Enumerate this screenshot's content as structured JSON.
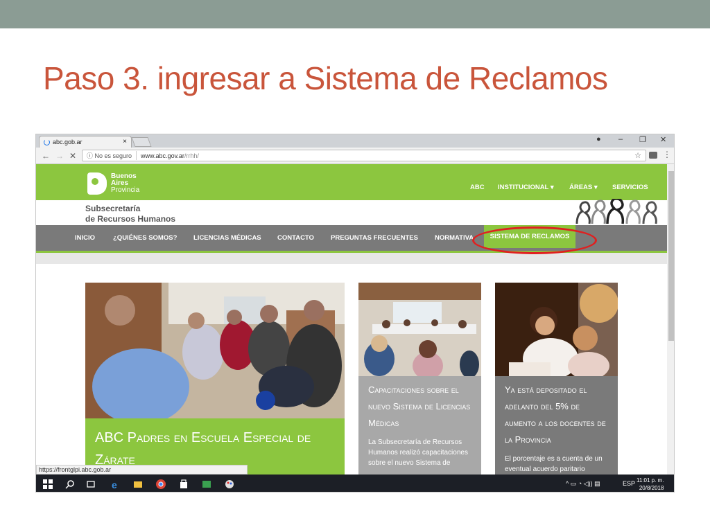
{
  "slide": {
    "title": "Paso 3.  ingresar a Sistema de Reclamos"
  },
  "browser": {
    "tab_title": "abc.gob.ar",
    "tab_close": "×",
    "security_label": "No es seguro",
    "url_domain": "www.abc.gov.ar",
    "url_path": "/rrhh/",
    "back": "←",
    "forward": "→",
    "stop": "✕",
    "star": "☆",
    "menu": "⋮",
    "win_account": "●",
    "win_minimize": "–",
    "win_restore": "❐",
    "win_close": "✕",
    "status_url": "https://frontglpi.abc.gob.ar"
  },
  "site": {
    "logo": {
      "line1": "Buenos",
      "line2": "Aires",
      "line3": "Provincia"
    },
    "top_nav": [
      "ABC",
      "INSTITUCIONAL ▾",
      "ÁREAS ▾",
      "SERVICIOS"
    ],
    "subsecretaria": {
      "line1": "Subsecretaría",
      "line2": "de Recursos Humanos"
    },
    "main_nav": [
      "INICIO",
      "¿QUIÉNES SOMOS?",
      "LICENCIAS MÉDICAS",
      "CONTACTO",
      "PREGUNTAS FRECUENTES",
      "NORMATIVA"
    ],
    "main_nav_active": "SISTEMA DE RECLAMOS",
    "cards": [
      {
        "title": "ABC Padres en Escuela Especial de Zárate"
      },
      {
        "title": "Capacitaciones sobre el nuevo Sistema de Licencias Médicas",
        "text": "La Subsecretaría de Recursos Humanos realizó capacitaciones sobre el nuevo Sistema de"
      },
      {
        "title": "Ya está depositado el adelanto del 5% de aumento a los docentes de la Provincia",
        "text": "El porcentaje es a cuenta de un eventual acuerdo paritario"
      }
    ]
  },
  "taskbar": {
    "tray_lang": "ESP",
    "tray_icons": "^ ▭ ◔ ◁)) ▤",
    "time": "11:01 p. m.",
    "date": "20/8/2018"
  },
  "colors": {
    "accent_green": "#8cc63f",
    "nav_gray": "#7a7a7a",
    "title_red": "#c9553b",
    "highlight_ellipse": "#e02020"
  }
}
